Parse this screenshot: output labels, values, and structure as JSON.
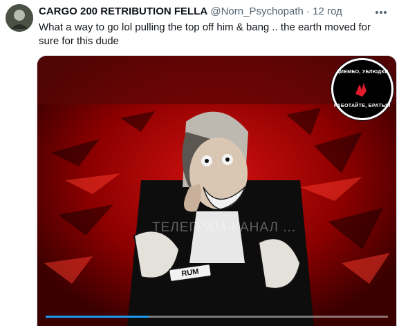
{
  "tweet": {
    "display_name": "CARGO 200 RETRIBUTION FELLA",
    "handle": "@Norn_Psychopath",
    "separator": "·",
    "timestamp": "12 год",
    "text": "What a way to go lol pulling the top off him & bang .. the earth moved for sure for this dude",
    "more_icon": "more-horizontal-icon"
  },
  "media": {
    "watermark": "ТЕЛЕГРАМ-КАНАЛ ...",
    "logo_top": "ДИЕМБО, УБЛЮДКИ",
    "logo_bottom": "РАБОТАЙТЕ, БРАТЬЯ!",
    "tattoo_text": "RUM",
    "progress_fraction": 0.3,
    "accent_color": "#1d9bf0",
    "background_color": "#8b0000"
  }
}
